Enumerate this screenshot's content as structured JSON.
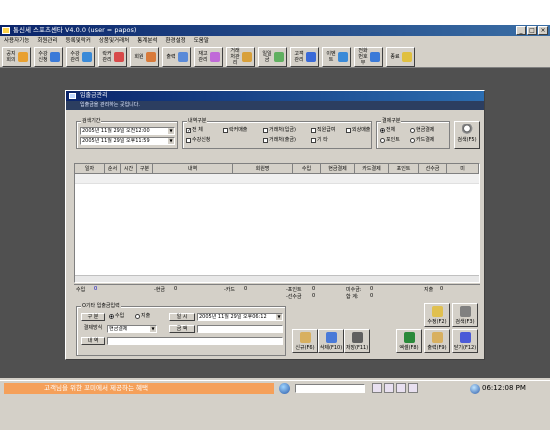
{
  "window": {
    "title": "통신세 스포츠센타 V4.0.0 (user = papos)",
    "min": "_",
    "max": "□",
    "close": "×"
  },
  "menu": [
    "사용자기능",
    "회원관리",
    "등록및락커",
    "상품및거래처",
    "통계분석",
    "환경설정",
    "도움말"
  ],
  "toolbar": [
    {
      "label": "공지회의",
      "icon": "notice-icon",
      "color": "#e8a030"
    },
    {
      "label": "수강신청",
      "icon": "shoe-icon",
      "color": "#3a7ad8"
    },
    {
      "label": "수강관리",
      "icon": "monitor-icon",
      "color": "#3a8ad8"
    },
    {
      "label": "락커관리",
      "icon": "locker-icon",
      "color": "#d84a4a"
    },
    {
      "label": "회원",
      "icon": "people-icon",
      "color": "#d87a3a"
    },
    {
      "label": "출력",
      "icon": "print-icon",
      "color": "#5a8ad8"
    },
    {
      "label": "재고관리",
      "icon": "box-icon",
      "color": "#c06ad8"
    },
    {
      "label": "거래처관리",
      "icon": "tools-icon",
      "color": "#d8a03a"
    },
    {
      "label": "일일금",
      "icon": "cash-icon",
      "color": "#60b060"
    },
    {
      "label": "고객관리",
      "icon": "info-icon",
      "color": "#3a6ad8"
    },
    {
      "label": "이벤트",
      "icon": "question-icon",
      "color": "#3a8ad8"
    },
    {
      "label": "전화번호부",
      "icon": "phone-icon",
      "color": "#3a7ad8"
    },
    {
      "label": "종료",
      "icon": "exit-icon",
      "color": "#e0c040"
    }
  ],
  "child": {
    "title": "입출금관리",
    "subtitle": "입출금을 관리하는 곳입니다."
  },
  "filters": {
    "period_label": "검색기간",
    "from": "2005년 11월 29일 오전12:00",
    "to": "2005년 11월 29일 오후11:59",
    "type_label": "내역구분",
    "checks": [
      "전 체",
      "락커매출",
      "거래처(입금)",
      "직원급여",
      "외상매출",
      "수강신청",
      "거래처(출금)",
      "기 타"
    ],
    "pay_label": "결제구분",
    "pay": [
      "전체",
      "현금결제",
      "포인트",
      "카드결제"
    ],
    "search": "검색(F5)"
  },
  "grid": {
    "columns": [
      "일자",
      "순서",
      "시간",
      "구분",
      "내역",
      "회원명",
      "수입",
      "현금결제",
      "카드결제",
      "포인트",
      "선수금",
      "미"
    ]
  },
  "summary": {
    "income_label": "수입",
    "income": "0",
    "cash_label": "-현금",
    "cash": "0",
    "card_label": "-카드",
    "card": "0",
    "point_label": "-포인트",
    "point": "0",
    "prepay_label": "-선수금",
    "prepay": "0",
    "unpaid_label": "미수금:",
    "unpaid": "0",
    "total_label": "합 계:",
    "total": "0",
    "expense_label": "지출",
    "expense": "0"
  },
  "entry": {
    "title": "O기타 입출금입력",
    "type_btn": "구 분",
    "in": "수입",
    "out": "지출",
    "date_btn": "일 시",
    "date": "2005년 11월 29일 오후06:12",
    "method_label": "결제방식",
    "method": "현금결제",
    "amount_btn": "금 액",
    "memo_btn": "내 역"
  },
  "buttons": [
    {
      "label": "신규(F6)",
      "icon": "new-icon",
      "color": "#d8b060"
    },
    {
      "label": "삭제(F10)",
      "icon": "trash-icon",
      "color": "#4a7ad8"
    },
    {
      "label": "저장(F11)",
      "icon": "save-icon",
      "color": "#606060"
    },
    {
      "label": "엑셀(F8)",
      "icon": "excel-icon",
      "color": "#2a8a3a"
    },
    {
      "label": "출력(F9)",
      "icon": "printer-icon",
      "color": "#d8b060"
    },
    {
      "label": "닫기(F12)",
      "icon": "close-door-icon",
      "color": "#4a5ad8"
    },
    {
      "label": "수정(F2)",
      "icon": "edit-icon",
      "color": "#e0c050"
    },
    {
      "label": "검색(F3)",
      "icon": "magnifier-icon",
      "color": "#808080"
    }
  ],
  "taskbar": {
    "marquee": "고객님을 위한 꼬미에서 제공하는 혜택",
    "time": "06:12:08 PM"
  }
}
